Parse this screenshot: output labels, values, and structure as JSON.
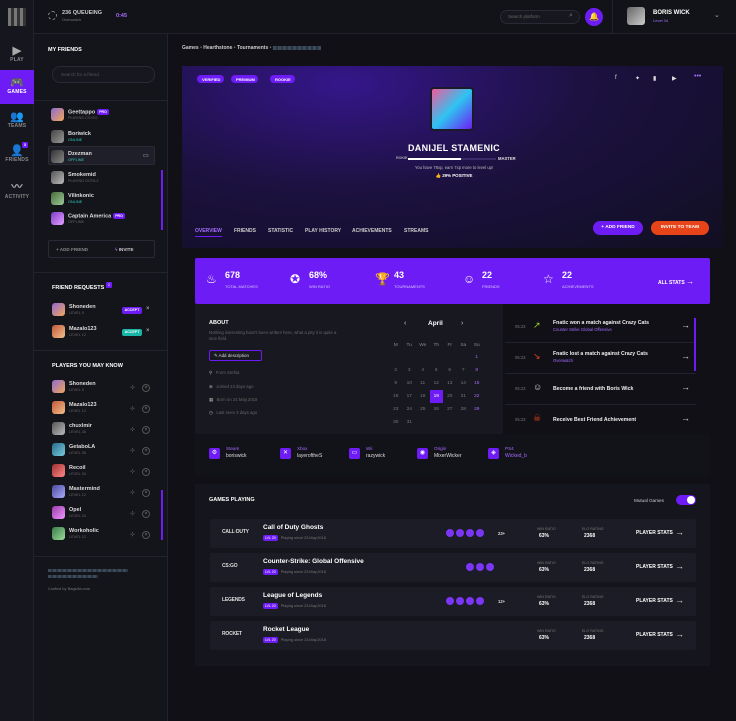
{
  "nav": {
    "items": [
      {
        "icon": "play-icon",
        "label": "PLAY"
      },
      {
        "icon": "gamepad-icon",
        "label": "GAMES"
      },
      {
        "icon": "teams-icon",
        "label": "TEAMS"
      },
      {
        "icon": "friends-icon",
        "label": "FRIENDS",
        "badge": "3"
      },
      {
        "icon": "activity-icon",
        "label": "ACTIVITY"
      }
    ]
  },
  "topbar": {
    "queue": "236 QUEUEING",
    "queue_sub": "Overwatch",
    "timer": "0:45",
    "search_placeholder": "Search platform",
    "user": "BORIS WICK",
    "level": "Level 34"
  },
  "friends": {
    "title": "MY FRIENDS",
    "search_placeholder": "Search for a friend",
    "list": [
      {
        "name": "Geettappo",
        "pill": "PRO",
        "status": "PLAYING CS:GO"
      },
      {
        "name": "Boriwick",
        "status": "ONLINE"
      },
      {
        "name": "Dzezman",
        "status": "OFFLINE"
      },
      {
        "name": "Smokemid",
        "status": "PLAYING DOTA 2"
      },
      {
        "name": "Vilinkonic",
        "status": "ONLINE"
      },
      {
        "name": "Captain America",
        "pill": "PRO",
        "status": "OFFLINE"
      }
    ],
    "add": "ADD FRIEND",
    "invite": "INVITE"
  },
  "requests": {
    "title": "FRIEND REQUESTS",
    "badge": "2",
    "list": [
      {
        "name": "Shoneden",
        "level": "LEVEL 5",
        "action": "ACCEPT"
      },
      {
        "name": "Mazalo123",
        "level": "LEVEL 12",
        "action": "ACCEPT"
      }
    ]
  },
  "know": {
    "title": "PLAYERS YOU MAY KNOW",
    "list": [
      {
        "name": "Shoneden",
        "level": "LEVEL 5"
      },
      {
        "name": "Mazalo123",
        "level": "LEVEL 12"
      },
      {
        "name": "chuxlmir",
        "level": "LEVEL 36"
      },
      {
        "name": "GetaboLA",
        "level": "LEVEL 36"
      },
      {
        "name": "Recoil",
        "level": "LEVEL 34"
      },
      {
        "name": "Mastermind",
        "level": "LEVEL 12"
      },
      {
        "name": "Opel",
        "level": "LEVEL 24"
      },
      {
        "name": "Workoholic",
        "level": "LEVEL 12"
      }
    ]
  },
  "credit": "Crafted by Bagwila.com",
  "breadcrumb": [
    "Games",
    "Hearthstone",
    "Tournaments"
  ],
  "profile": {
    "tags": [
      "VERIFIED",
      "PREMIUM",
      "ROOKIE"
    ],
    "name": "DANIJEL STAMENIC",
    "rank_from": "ROKIE",
    "rank_to": "MASTER",
    "xp_text": "You have 78xp, earn 7xp more to level up!",
    "positive": "29% POSITIVE"
  },
  "tabs": [
    "OVERVIEW",
    "FRIENDS",
    "STATISTIC",
    "PLAY HISTORY",
    "ACHIEVEMENTS",
    "STREAMS"
  ],
  "buttons": {
    "add_friend": "ADD FRIEND",
    "invite_team": "INVITE TO TEAM"
  },
  "stats": [
    {
      "icon": "fire-icon",
      "value": "678",
      "label": "TOTAL MATCHES"
    },
    {
      "icon": "medal-icon",
      "value": "68%",
      "label": "WIN RATIO"
    },
    {
      "icon": "trophy-icon",
      "value": "43",
      "label": "TOURNAMENTS"
    },
    {
      "icon": "user-icon",
      "value": "22",
      "label": "FRIENDS"
    },
    {
      "icon": "star-icon",
      "value": "22",
      "label": "ACHIEVEMENTS"
    }
  ],
  "all_stats": "ALL STATS",
  "about": {
    "title": "ABOUT",
    "text": "Nothing interesting hasn't been written here, what a pity it is quite a nice field.",
    "add": "Add description",
    "items": [
      "From Serbia",
      "Joined 23 days ago",
      "Born on 24.May.2018",
      "Last seen 3 days ago"
    ]
  },
  "calendar": {
    "month": "April",
    "days": [
      "M",
      "Tu",
      "We",
      "Th",
      "Fr",
      "Sa",
      "Su"
    ],
    "weeks": [
      [
        "",
        "",
        "",
        "",
        "",
        "",
        "1"
      ],
      [
        "2",
        "3",
        "4",
        "5",
        "6",
        "7",
        "8"
      ],
      [
        "9",
        "10",
        "11",
        "12",
        "13",
        "14",
        "15"
      ],
      [
        "16",
        "17",
        "18",
        "19",
        "20",
        "21",
        "22"
      ],
      [
        "23",
        "24",
        "25",
        "26",
        "27",
        "28",
        "29"
      ],
      [
        "30",
        "31",
        "",
        "",
        "",
        "",
        ""
      ]
    ],
    "today": "19"
  },
  "activity": [
    {
      "time": "05:23",
      "text": "Fnatic won a match against Crazy Cats",
      "sub": "Counter Strike Global Offensive"
    },
    {
      "time": "05:23",
      "text": "Fnatic lost a match against Crazy Cats",
      "sub": "Overwatch"
    },
    {
      "time": "05:23",
      "text": "Become a friend with Boris Wick",
      "sub": ""
    },
    {
      "time": "05:23",
      "text": "Receive Best Friend Achievement",
      "sub": ""
    }
  ],
  "platforms": [
    {
      "name": "Steam",
      "user": "boriswick"
    },
    {
      "name": "Xbox",
      "user": "layeroftheS"
    },
    {
      "name": "Wii",
      "user": "razywick"
    },
    {
      "name": "Origin",
      "user": "MixerWicker"
    },
    {
      "name": "PS4",
      "user": "Wicked_b"
    }
  ],
  "games": {
    "title": "GAMES PLAYING",
    "mutual": "Mutual Games",
    "player_stats": "PLAYER STATS",
    "list": [
      {
        "logo": "CALL·DUTY",
        "name": "Call of Duty Ghosts",
        "level": "LVL 20",
        "since": "Playing since 23.May.2018",
        "more": "23+",
        "win": "63%",
        "rating": "2368",
        "win_label": "WIN RATIO",
        "rating_label": "ELO RATING"
      },
      {
        "logo": "CS:GO",
        "name": "Counter-Strike: Global Offensive",
        "level": "LVL 20",
        "since": "Playing since 23.May.2018",
        "more": "",
        "win": "63%",
        "rating": "2368",
        "win_label": "WIN RATIO",
        "rating_label": "ELO RATING"
      },
      {
        "logo": "LEGENDS",
        "name": "League of Legends",
        "level": "LVL 20",
        "since": "Playing since 23.May.2018",
        "more": "12+",
        "win": "63%",
        "rating": "2368",
        "win_label": "WIN RATIO",
        "rating_label": "ELO RATING"
      },
      {
        "logo": "ROCKET",
        "name": "Rocket League",
        "level": "LVL 20",
        "since": "Playing since 23.May.2018",
        "more": "",
        "win": "63%",
        "rating": "2368",
        "win_label": "WIN RATIO",
        "rating_label": "ELO RATING"
      }
    ]
  }
}
